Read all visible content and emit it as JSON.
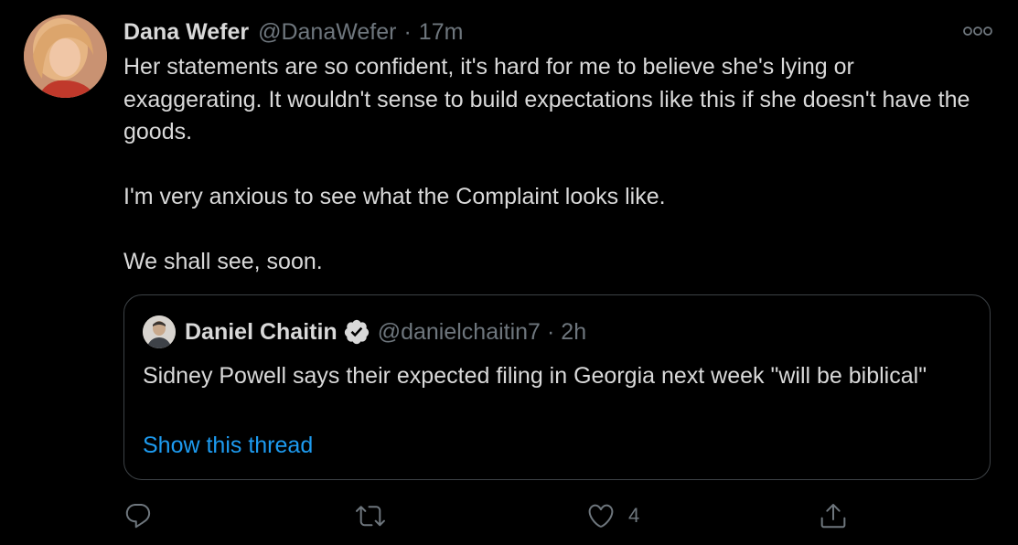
{
  "author": {
    "display_name": "Dana Wefer",
    "handle": "@DanaWefer",
    "separator": "·",
    "time": "17m"
  },
  "tweet": {
    "paragraphs": [
      "Her statements are so confident, it's hard for me to believe she's lying or exaggerating. It wouldn't sense to build expectations like this if she doesn't have the goods.",
      "I'm very anxious to see what the Complaint looks like.",
      "We shall see, soon."
    ]
  },
  "quoted": {
    "display_name": "Daniel Chaitin",
    "handle": "@danielchaitin7",
    "separator": "·",
    "time": "2h",
    "text": "Sidney Powell says their expected filing in Georgia next week \"will be biblical\"",
    "show_thread": "Show this thread"
  },
  "actions": {
    "reply_icon": "reply-icon",
    "retweet_icon": "retweet-icon",
    "like_icon": "heart-icon",
    "like_count": "4",
    "share_icon": "share-icon"
  },
  "colors": {
    "background": "#000000",
    "text": "#d9d9d9",
    "secondary": "#6e767d",
    "link": "#1d9bf0",
    "border": "#3d4246"
  }
}
